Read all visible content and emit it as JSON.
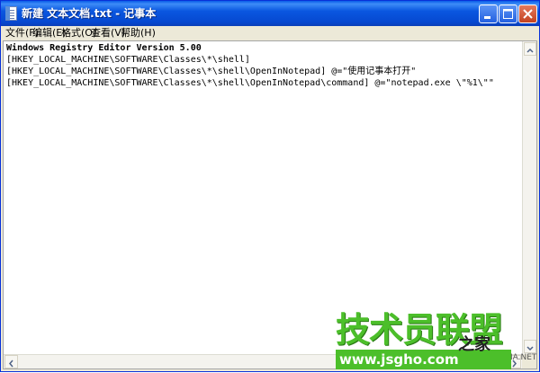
{
  "window": {
    "title": "新建 文本文档.txt - 记事本",
    "icon": "notepad-icon",
    "controls": [
      "minimize-icon",
      "maximize-icon",
      "close-icon"
    ]
  },
  "menu": {
    "items": [
      "文件(F)",
      "编辑(E)",
      "格式(O)",
      "查看(V)",
      "帮助(H)"
    ]
  },
  "editor": {
    "lines": [
      "Windows Registry Editor Version 5.00",
      "[HKEY_LOCAL_MACHINE\\SOFTWARE\\Classes\\*\\shell]",
      "[HKEY_LOCAL_MACHINE\\SOFTWARE\\Classes\\*\\shell\\OpenInNotepad] @=\"使用记事本打开\"",
      "[HKEY_LOCAL_MACHINE\\SOFTWARE\\Classes\\*\\shell\\OpenInNotepad\\command] @=\"notepad.exe \\\"%1\\\"\""
    ]
  },
  "watermark": {
    "brand": "技术员联盟",
    "suffix": "之家",
    "url": "www.jsgho.com",
    "tail": "IA.NET"
  },
  "colors": {
    "titlebar": "#0a57e0",
    "menubar": "#ece9d8",
    "close_button": "#c3421f",
    "watermark_green": "#4cbf2a"
  }
}
